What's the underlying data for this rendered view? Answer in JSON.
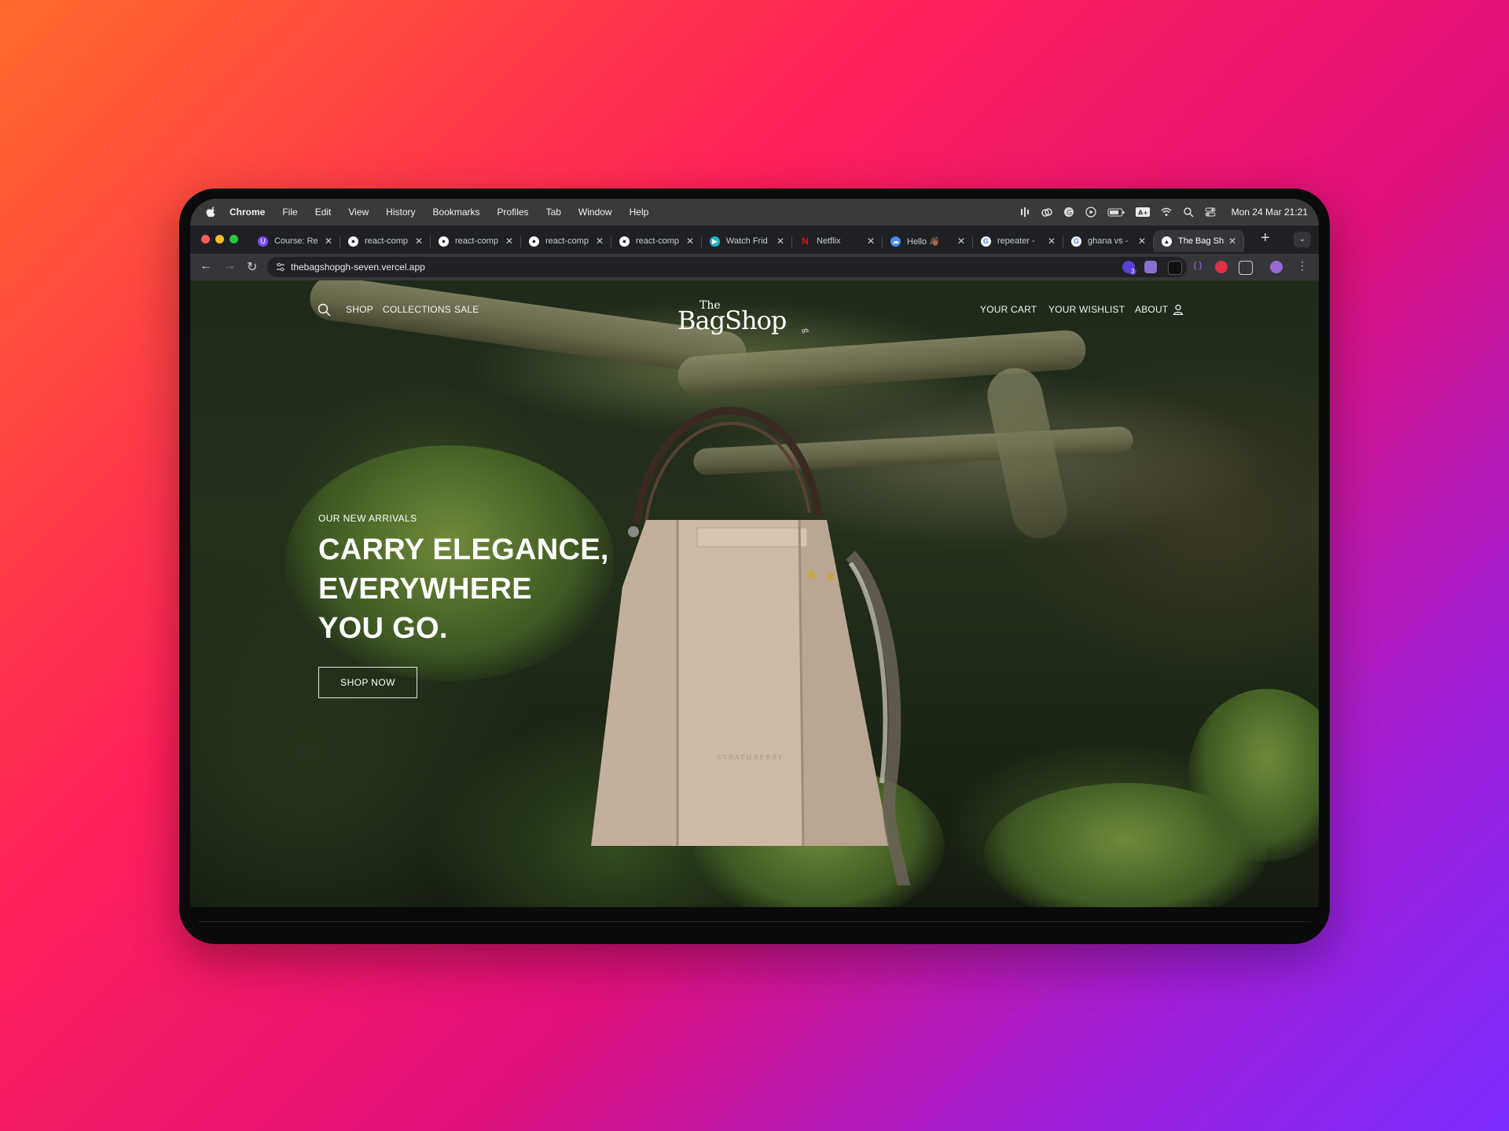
{
  "menubar": {
    "app_name": "Chrome",
    "items": [
      "File",
      "Edit",
      "View",
      "History",
      "Bookmarks",
      "Profiles",
      "Tab",
      "Window",
      "Help"
    ],
    "datetime": "Mon 24 Mar  21:21"
  },
  "tabs": [
    {
      "title": "Course: Re",
      "icon": "course-icon",
      "color": "#7a4cff"
    },
    {
      "title": "react-comp",
      "icon": "github-icon",
      "color": "#ffffff"
    },
    {
      "title": "react-comp",
      "icon": "github-icon",
      "color": "#ffffff"
    },
    {
      "title": "react-comp",
      "icon": "github-icon",
      "color": "#ffffff"
    },
    {
      "title": "react-comp",
      "icon": "github-icon",
      "color": "#ffffff"
    },
    {
      "title": "Watch Frid",
      "icon": "play-icon",
      "color": "#1fb6c9"
    },
    {
      "title": "Netflix",
      "icon": "netflix-icon",
      "color": "#e50914"
    },
    {
      "title": "Hello 👋🏾",
      "icon": "hello-icon",
      "color": "#4a8cff"
    },
    {
      "title": "repeater - ",
      "icon": "google-icon",
      "color": "#ffffff"
    },
    {
      "title": "ghana vs -",
      "icon": "google-icon",
      "color": "#ffffff"
    },
    {
      "title": "The Bag Sh",
      "icon": "vercel-icon",
      "color": "#ffffff"
    }
  ],
  "toolbar": {
    "url": "thebagshopgh-seven.vercel.app",
    "extension_badge": "3"
  },
  "site": {
    "nav_left": [
      "SHOP",
      "COLLECTIONS",
      "SALE"
    ],
    "nav_right": [
      "YOUR CART",
      "YOUR WISHLIST",
      "ABOUT"
    ],
    "logo_the": "The",
    "logo_name": "BagShop",
    "logo_suffix": "gh",
    "hero_kicker": "OUR NEW ARRIVALS",
    "hero_line1": "CARRY ELEGANCE,",
    "hero_line2": "EVERYWHERE",
    "hero_line3": "YOU GO.",
    "hero_button": "SHOP NOW",
    "bag_brand": "STRATHBERRY"
  },
  "colors": {
    "accent_gradient_start": "#ff6a2b",
    "accent_gradient_end": "#7b2cff",
    "bag": "#c9b8a6"
  }
}
